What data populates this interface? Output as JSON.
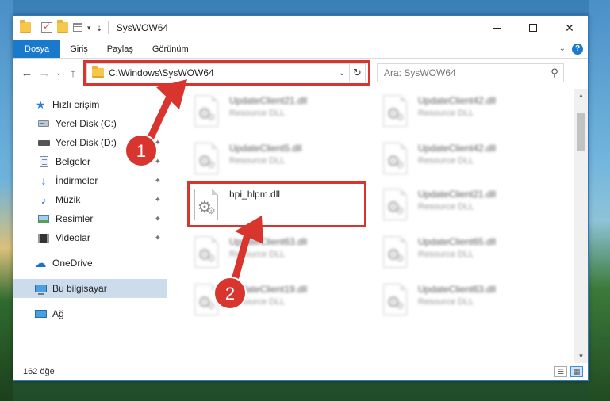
{
  "window": {
    "title": "SysWOW64",
    "controls": {
      "minimize": "—",
      "maximize": "",
      "close": "✕"
    }
  },
  "ribbon": {
    "tabs": [
      {
        "label": "Dosya"
      },
      {
        "label": "Giriş"
      },
      {
        "label": "Paylaş"
      },
      {
        "label": "Görünüm"
      }
    ],
    "expand_glyph": "⌄",
    "help_glyph": "?"
  },
  "nav": {
    "back": "←",
    "forward": "→",
    "recent": "⌄",
    "up": "↑"
  },
  "address": {
    "path": "C:\\Windows\\SysWOW64",
    "drop": "⌄",
    "refresh": "↻"
  },
  "search": {
    "placeholder": "Ara: SysWOW64",
    "icon": "⚲"
  },
  "sidebar": {
    "items": [
      {
        "label": "Hızlı erişim",
        "icon": "star-icon",
        "pinned": false
      },
      {
        "label": "Yerel Disk (C:)",
        "icon": "drive-icon",
        "pinned": true
      },
      {
        "label": "Yerel Disk (D:)",
        "icon": "drive-icon",
        "pinned": true
      },
      {
        "label": "Belgeler",
        "icon": "documents-icon",
        "pinned": true
      },
      {
        "label": "İndirmeler",
        "icon": "downloads-icon",
        "pinned": true
      },
      {
        "label": "Müzik",
        "icon": "music-icon",
        "pinned": true
      },
      {
        "label": "Resimler",
        "icon": "pictures-icon",
        "pinned": true
      },
      {
        "label": "Videolar",
        "icon": "videos-icon",
        "pinned": true
      },
      {
        "label": "OneDrive",
        "icon": "cloud-icon",
        "pinned": false
      },
      {
        "label": "Bu bilgisayar",
        "icon": "computer-icon",
        "pinned": false
      },
      {
        "label": "Ağ",
        "icon": "network-icon",
        "pinned": false
      }
    ],
    "pin_glyph": "📌"
  },
  "files": [
    {
      "name": "UpdateClient21.dll",
      "type": "Resource DLL"
    },
    {
      "name": "UpdateClient42.dll",
      "type": "Resource DLL"
    },
    {
      "name": "UpdateClient5.dll",
      "type": "Resource DLL"
    },
    {
      "name": "UpdateClient42.dll",
      "type": "Resource DLL"
    },
    {
      "name": "hpi_hlpm.dll",
      "type": ""
    },
    {
      "name": "UpdateClient21.dll",
      "type": "Resource DLL"
    },
    {
      "name": "UpdateClient63.dll",
      "type": "Resource DLL"
    },
    {
      "name": "UpdateClient65.dll",
      "type": "Resource DLL"
    },
    {
      "name": "UpdateClient19.dll",
      "type": "Resource DLL"
    },
    {
      "name": "UpdateClient63.dll",
      "type": "Resource DLL"
    }
  ],
  "status": {
    "count": "162 öğe"
  },
  "annotations": {
    "step1": "1",
    "step2": "2",
    "color": "#d9352f"
  }
}
